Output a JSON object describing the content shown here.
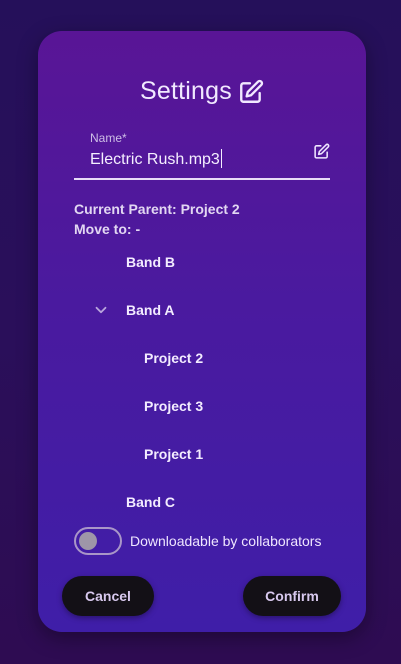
{
  "dialog": {
    "title": "Settings",
    "title_icon": "edit-icon",
    "name_field": {
      "label": "Name*",
      "value": "Electric Rush.mp3",
      "icon": "edit-icon"
    },
    "current_parent": "Current Parent: Project 2",
    "move_to": "Move to: -",
    "tree": [
      {
        "label": "Band B",
        "level": 1,
        "expanded": false
      },
      {
        "label": "Band A",
        "level": 1,
        "expanded": true,
        "chevron_icon": "chevron-down-icon"
      },
      {
        "label": "Project 2",
        "level": 2
      },
      {
        "label": "Project 3",
        "level": 2
      },
      {
        "label": "Project 1",
        "level": 2
      },
      {
        "label": "Band C",
        "level": 1,
        "expanded": false
      }
    ],
    "toggle": {
      "label": "Downloadable by collaborators",
      "checked": false
    },
    "buttons": {
      "cancel": "Cancel",
      "confirm": "Confirm"
    }
  },
  "colors": {
    "background_top": "#25105a",
    "dialog_top": "#591596",
    "dialog_bottom": "#3f1ea8",
    "button_bg": "#131016",
    "text": "#f3ecff"
  }
}
